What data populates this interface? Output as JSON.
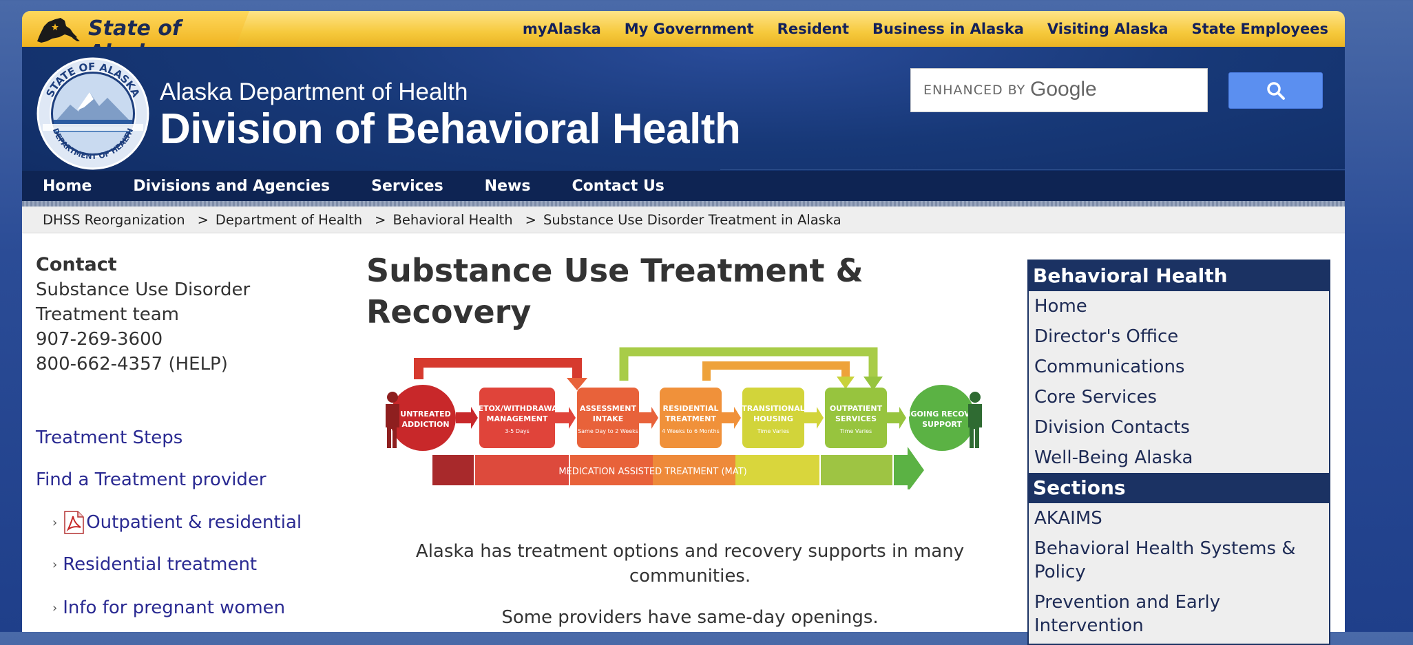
{
  "topbar": {
    "brand": "State of Alaska",
    "links": [
      "myAlaska",
      "My Government",
      "Resident",
      "Business in Alaska",
      "Visiting Alaska",
      "State Employees"
    ]
  },
  "header": {
    "department": "Alaska Department of Health",
    "division": "Division of Behavioral Health",
    "seal_text_top": "STATE OF ALASKA",
    "seal_text_bottom": "DEPARTMENT OF HEALTH",
    "search": {
      "enhanced_by": "ENHANCED BY",
      "google": "Google"
    }
  },
  "nav": [
    "Home",
    "Divisions and Agencies",
    "Services",
    "News",
    "Contact Us"
  ],
  "breadcrumb": [
    "DHSS Reorganization",
    "Department of Health",
    "Behavioral Health",
    "Substance Use Disorder Treatment in Alaska"
  ],
  "breadcrumb_separator": ">",
  "left": {
    "contact_heading": "Contact",
    "contact_lines": [
      "Substance Use Disorder",
      "Treatment team",
      "907-269-3600",
      "800-662-4357 (HELP)"
    ],
    "links": [
      "Treatment Steps",
      "Find a Treatment provider"
    ],
    "sublinks": [
      "Outpatient & residential",
      "Residential treatment",
      "Info for pregnant women"
    ]
  },
  "main": {
    "title": "Substance Use Treatment & Recovery",
    "paragraphs": [
      "Alaska has treatment options and recovery supports in many communities.",
      "Some providers have same-day openings."
    ]
  },
  "diagram": {
    "stages": [
      {
        "label": "UNTREATED ADDICTION",
        "sub": "",
        "color": "#c8282a"
      },
      {
        "label": "DETOX/WITHDRAWAL MANAGEMENT",
        "sub": "3-5 Days",
        "color": "#e0443a"
      },
      {
        "label": "ASSESSMENT INTAKE",
        "sub": "Same Day to 2 Weeks",
        "color": "#e8623a"
      },
      {
        "label": "RESIDENTIAL TREATMENT",
        "sub": "4 Weeks to 6 Months",
        "color": "#f0913a"
      },
      {
        "label": "TRANSITIONAL HOUSING",
        "sub": "Time Varies",
        "color": "#d2d43a"
      },
      {
        "label": "OUTPATIENT SERVICES",
        "sub": "Time Varies",
        "color": "#97c43e"
      },
      {
        "label": "ONGOING RECOVERY SUPPORT",
        "sub": "",
        "color": "#5bb244"
      }
    ],
    "bar_label": "MEDICATION ASSISTED TREATMENT (MAT)"
  },
  "sidebar": {
    "heading1": "Behavioral Health",
    "items1": [
      "Home",
      "Director's Office",
      "Communications",
      "Core Services",
      "Division Contacts",
      "Well-Being Alaska"
    ],
    "heading2": "Sections",
    "items2": [
      "AKAIMS",
      "Behavioral Health Systems & Policy",
      "Prevention and Early Intervention"
    ]
  }
}
